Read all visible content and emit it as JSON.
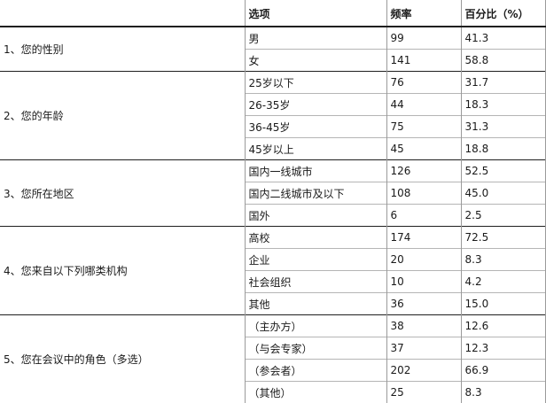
{
  "header": {
    "question": "",
    "option": "选项",
    "frequency": "频率",
    "percent": "百分比（%）"
  },
  "groups": [
    {
      "question": "1、您的性别",
      "rows": [
        {
          "option": "男",
          "freq": "99",
          "pct": "41.3"
        },
        {
          "option": "女",
          "freq": "141",
          "pct": "58.8"
        }
      ]
    },
    {
      "question": "2、您的年龄",
      "rows": [
        {
          "option": "25岁以下",
          "freq": "76",
          "pct": "31.7"
        },
        {
          "option": "26-35岁",
          "freq": "44",
          "pct": "18.3"
        },
        {
          "option": "36-45岁",
          "freq": "75",
          "pct": "31.3"
        },
        {
          "option": "45岁以上",
          "freq": "45",
          "pct": "18.8"
        }
      ]
    },
    {
      "question": "3、您所在地区",
      "rows": [
        {
          "option": "国内一线城市",
          "freq": "126",
          "pct": "52.5"
        },
        {
          "option": "国内二线城市及以下",
          "freq": "108",
          "pct": "45.0"
        },
        {
          "option": "国外",
          "freq": "6",
          "pct": "2.5"
        }
      ]
    },
    {
      "question": "4、您来自以下列哪类机构",
      "rows": [
        {
          "option": "高校",
          "freq": "174",
          "pct": "72.5"
        },
        {
          "option": "企业",
          "freq": "20",
          "pct": "8.3"
        },
        {
          "option": "社会组织",
          "freq": "10",
          "pct": "4.2"
        },
        {
          "option": "其他",
          "freq": "36",
          "pct": "15.0"
        }
      ]
    },
    {
      "question": "5、您在会议中的角色（多选）",
      "rows": [
        {
          "option": "（主办方）",
          "freq": "38",
          "pct": "12.6"
        },
        {
          "option": "（与会专家）",
          "freq": "37",
          "pct": "12.3"
        },
        {
          "option": "（参会者）",
          "freq": "202",
          "pct": "66.9"
        },
        {
          "option": "（其他）",
          "freq": "25",
          "pct": "8.3"
        }
      ]
    }
  ]
}
